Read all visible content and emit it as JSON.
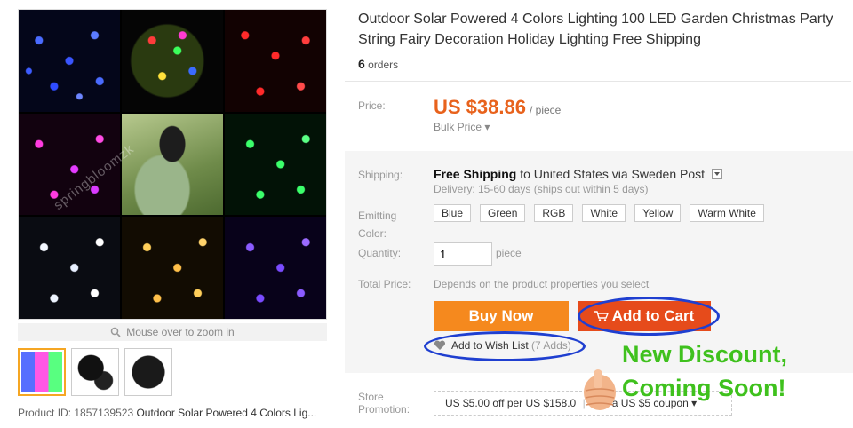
{
  "gallery": {
    "watermark": "springbloomzk",
    "zoom_hint": "Mouse over to zoom in",
    "product_id_label": "Product ID:",
    "product_id": "1857139523",
    "product_id_title": "Outdoor Solar Powered 4 Colors Lig..."
  },
  "product": {
    "title": "Outdoor Solar Powered 4 Colors Lighting 100 LED Garden Christmas Party String Fairy Decoration Holiday Lighting Free Shipping",
    "orders_count": "6",
    "orders_label": "orders"
  },
  "price": {
    "label": "Price:",
    "value": "US $38.86",
    "unit": "/ piece",
    "bulk": "Bulk Price ▾",
    "color": "#e8621c"
  },
  "shipping": {
    "label": "Shipping:",
    "method": "Free Shipping",
    "destination": "to  United States via Sweden Post",
    "delivery": "Delivery: 15-60 days (ships out within 5 days)"
  },
  "emitting_color": {
    "label": "Emitting Color:",
    "options": [
      "Blue",
      "Green",
      "RGB",
      "White",
      "Yellow",
      "Warm White"
    ]
  },
  "quantity": {
    "label": "Quantity:",
    "value": "1",
    "unit": "piece"
  },
  "total": {
    "label": "Total Price:",
    "value": "Depends on the product properties you select"
  },
  "actions": {
    "buy_now": "Buy Now",
    "add_to_cart": "Add to Cart",
    "wish_list": "Add to Wish List",
    "wish_count": "(7 Adds)",
    "buy_color": "#f5891e",
    "cart_color": "#e64b1b"
  },
  "promotion": {
    "label": "Store Promotion:",
    "offer": "US $5.00 off per US $158.0",
    "coupon": "Get a US $5 coupon ▾"
  },
  "overlay": {
    "line1": "New Discount,",
    "line2": "Coming Soon!",
    "color": "#3fc11d"
  }
}
